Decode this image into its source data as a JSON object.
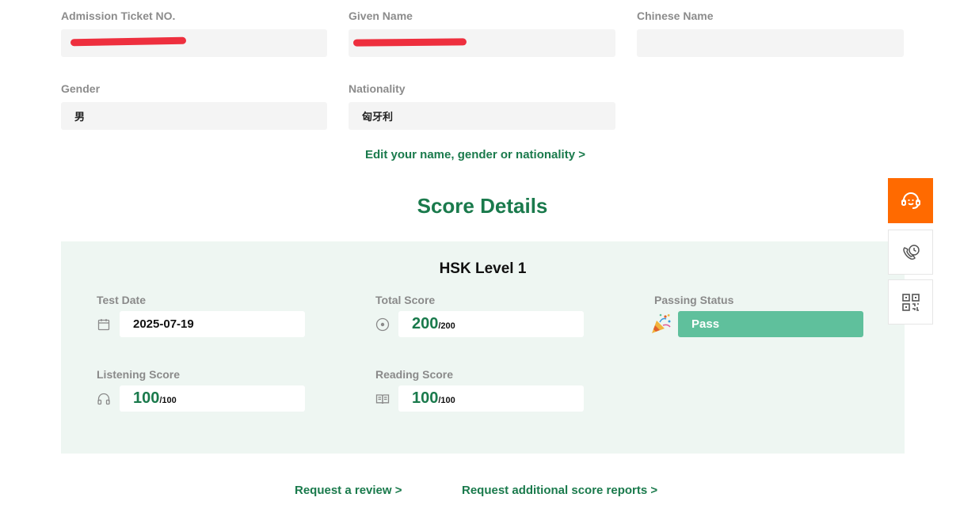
{
  "profile": {
    "admission_ticket_label": "Admission Ticket NO.",
    "admission_ticket_value": "",
    "given_name_label": "Given Name",
    "given_name_value": "",
    "chinese_name_label": "Chinese Name",
    "chinese_name_value": "",
    "gender_label": "Gender",
    "gender_value": "男",
    "nationality_label": "Nationality",
    "nationality_value": "匈牙利",
    "edit_link": "Edit your name, gender or nationality >"
  },
  "score_details": {
    "title": "Score Details",
    "level": "HSK Level 1",
    "test_date_label": "Test Date",
    "test_date_value": "2025-07-19",
    "total_score_label": "Total Score",
    "total_score_value": "200",
    "total_score_max": "/200",
    "passing_status_label": "Passing Status",
    "passing_status_value": "Pass",
    "listening_label": "Listening Score",
    "listening_value": "100",
    "listening_max": "/100",
    "reading_label": "Reading Score",
    "reading_value": "100",
    "reading_max": "/100"
  },
  "links": {
    "request_review": "Request a review >",
    "request_reports": "Request additional score reports >"
  },
  "side_toolbar": {
    "icons": [
      "customer-service-icon",
      "phone-clock-icon",
      "qr-code-icon"
    ]
  },
  "colors": {
    "accent_green": "#1a7a4c",
    "pass_green": "#5fc09c",
    "panel_bg": "#eef6f2",
    "side_orange": "#ff6a00",
    "redaction_red": "#ee2f3e"
  }
}
